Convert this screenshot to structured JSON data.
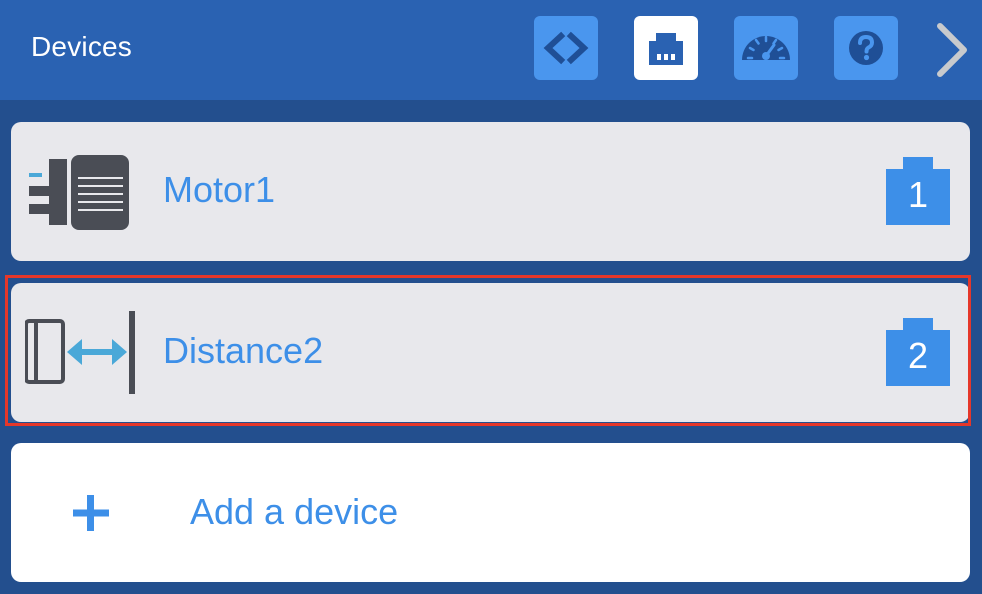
{
  "header": {
    "title": "Devices",
    "buttons": [
      {
        "icon": "code-brackets-icon",
        "state": "default"
      },
      {
        "icon": "ethernet-port-icon",
        "state": "active"
      },
      {
        "icon": "speedometer-icon",
        "state": "default"
      },
      {
        "icon": "help-question-icon",
        "state": "default"
      }
    ],
    "next_icon": "chevron-right-icon"
  },
  "devices": [
    {
      "name": "Motor1",
      "port": "1",
      "icon": "motor-icon",
      "selected": false
    },
    {
      "name": "Distance2",
      "port": "2",
      "icon": "distance-sensor-icon",
      "selected": true
    }
  ],
  "add_device": {
    "label": "Add a device",
    "icon": "plus-icon"
  },
  "colors": {
    "header_bg": "#2a62b2",
    "page_bg": "#234f8e",
    "accent_blue": "#3d8fe8",
    "button_blue": "#4a96ee",
    "card_bg": "#e8e8ec",
    "selection_outline": "#e5372a",
    "icon_dark": "#4a4d55",
    "icon_teal": "#4aa8d8"
  }
}
